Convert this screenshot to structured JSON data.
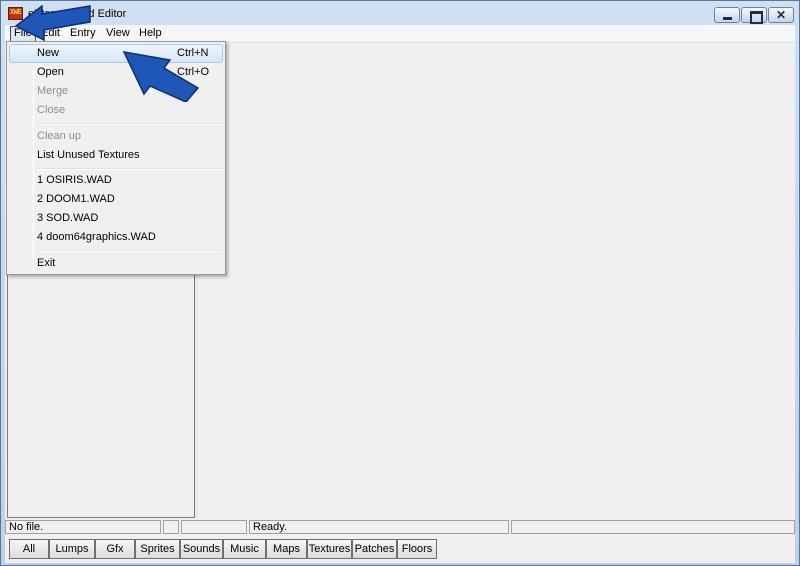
{
  "window": {
    "title": "eXtended Wad Editor",
    "title_visible": "eXter",
    "title_visible_tail": "ad Editor",
    "icon_label": "XWE",
    "icon": "xwe-app-icon"
  },
  "controls": {
    "minimize_icon": "minimize-icon",
    "maximize_icon": "maximize-icon",
    "close_glyph": "✕"
  },
  "menubar": {
    "items": [
      "File",
      "Edit",
      "Entry",
      "View",
      "Help"
    ],
    "active": "File"
  },
  "file_menu": {
    "items": [
      {
        "label": "New",
        "shortcut": "Ctrl+N",
        "state": "highlighted"
      },
      {
        "label": "Open",
        "shortcut": "Ctrl+O",
        "state": "enabled"
      },
      {
        "label": "Merge",
        "shortcut": "",
        "state": "disabled"
      },
      {
        "label": "Close",
        "shortcut": "",
        "state": "disabled"
      },
      {
        "label": "Clean up",
        "shortcut": "",
        "state": "disabled"
      },
      {
        "label": "List Unused Textures",
        "shortcut": "",
        "state": "enabled"
      },
      {
        "label": "1 OSIRIS.WAD",
        "shortcut": "",
        "state": "enabled"
      },
      {
        "label": "2 DOOM1.WAD",
        "shortcut": "",
        "state": "enabled"
      },
      {
        "label": "3 SOD.WAD",
        "shortcut": "",
        "state": "enabled"
      },
      {
        "label": "4 doom64graphics.WAD",
        "shortcut": "",
        "state": "enabled"
      },
      {
        "label": "Exit",
        "shortcut": "",
        "state": "enabled"
      }
    ]
  },
  "statusbar": {
    "file": "No file.",
    "cell2": "",
    "cell3": "",
    "message": "Ready.",
    "cell5": ""
  },
  "filter_tabs": [
    "All",
    "Lumps",
    "Gfx",
    "Sprites",
    "Sounds",
    "Music",
    "Maps",
    "Textures",
    "Patches",
    "Floors"
  ],
  "annotations": {
    "arrow_color": "#1f57b8",
    "arrow_icon": "pointer-arrow-icon"
  }
}
